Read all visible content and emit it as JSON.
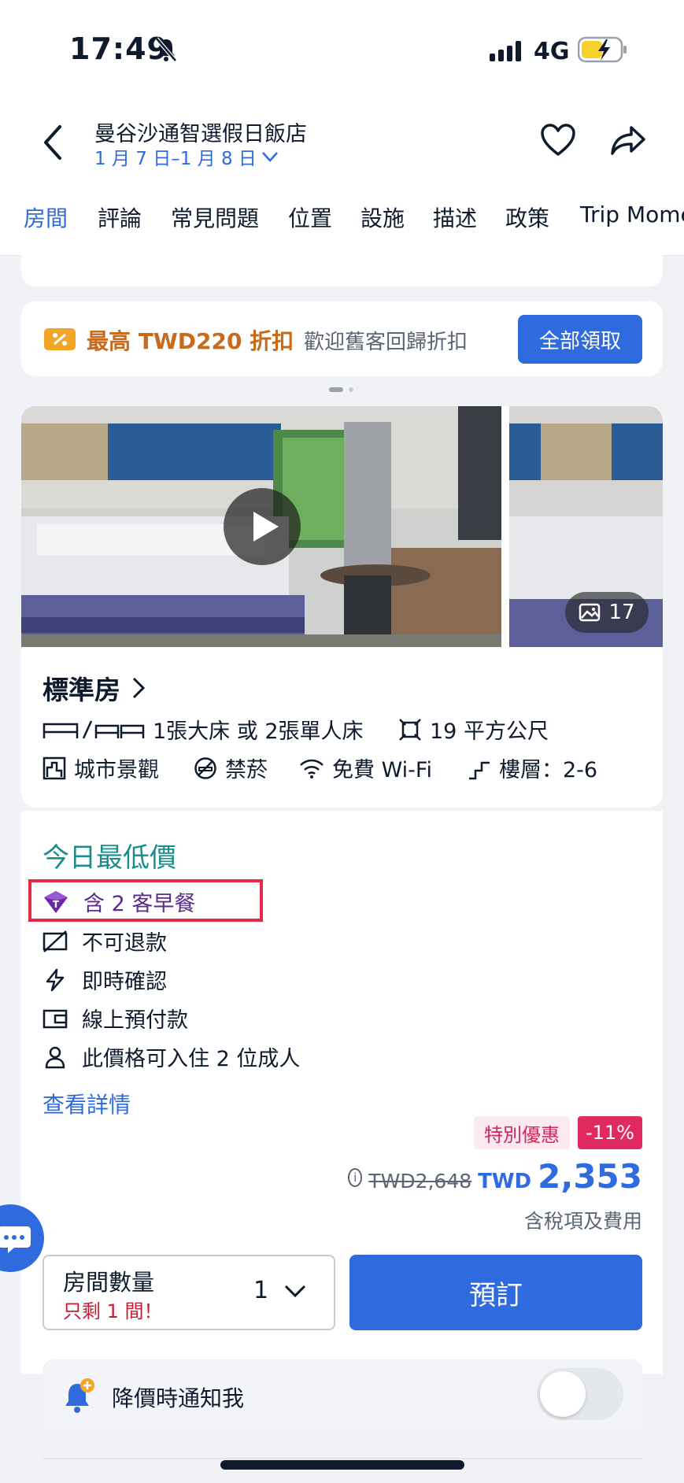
{
  "status_bar": {
    "time": "17:49",
    "network": "4G"
  },
  "header": {
    "hotel_name": "曼谷沙通智選假日飯店",
    "dates": "1 月 7 日–1 月 8 日",
    "tabs": [
      "房間",
      "評論",
      "常見問題",
      "位置",
      "設施",
      "描述",
      "政策",
      "Trip Mome"
    ],
    "active_tab": "房間"
  },
  "coupon": {
    "main": "最高 TWD220 折扣",
    "sub": "歡迎舊客回歸折扣",
    "button": "全部領取"
  },
  "room": {
    "photo_count": "17",
    "title": "標準房",
    "bed": "1張大床 或 2張單人床",
    "area": "19 平方公尺",
    "view": "城市景觀",
    "smoking": "禁菸",
    "wifi": "免費 Wi-Fi",
    "floor": "樓層：2-6"
  },
  "rate": {
    "title": "今日最低價",
    "breakfast": "含 2 客早餐",
    "refund": "不可退款",
    "confirm": "即時確認",
    "payment": "線上預付款",
    "occupancy": "此價格可入住 2 位成人",
    "details_link": "查看詳情",
    "special_badge": "特別優惠",
    "discount_badge": "-11%",
    "old_price": "TWD2,648",
    "currency": "TWD",
    "price": "2,353",
    "tax_note": "含稅項及費用"
  },
  "booking": {
    "qty_label": "房間數量",
    "qty_left": "只剩 1 間！",
    "qty_value": "1",
    "book_button": "預訂"
  },
  "notify": {
    "label": "降價時通知我",
    "enabled": false
  },
  "colors": {
    "accent": "#2f6bde",
    "teal": "#1a8c8c",
    "coupon_orange": "#c86a1a",
    "discount_red": "#e02a5f"
  }
}
